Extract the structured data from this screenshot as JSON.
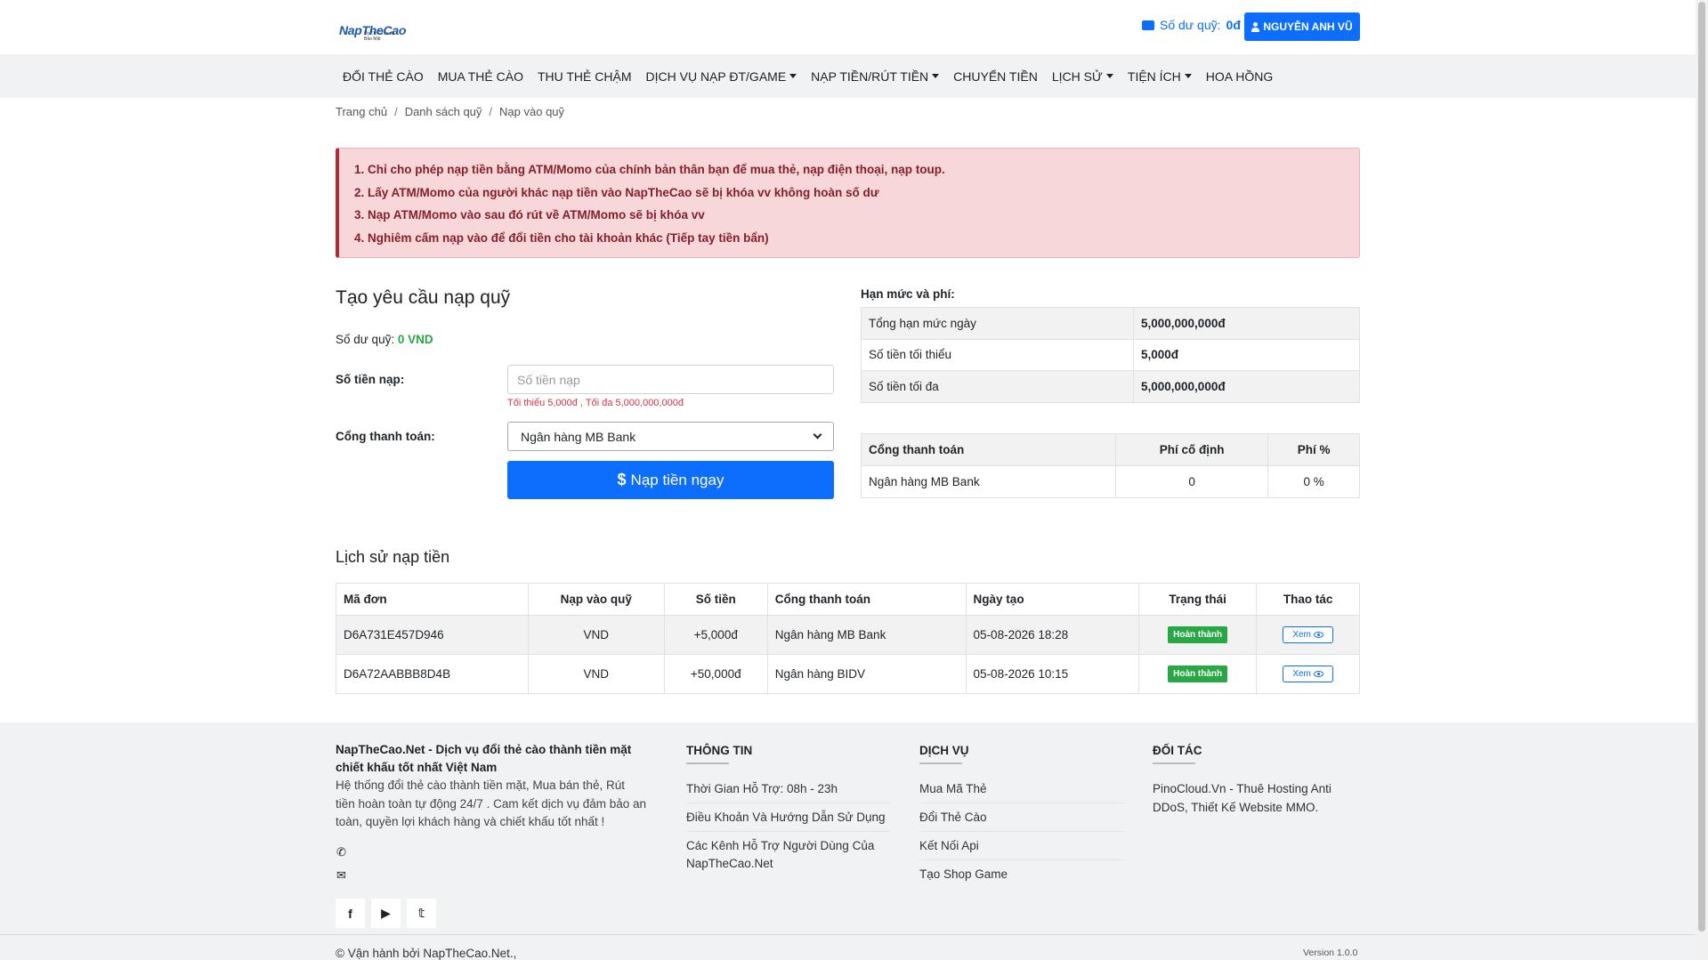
{
  "header": {
    "logo_text": "NapTheCao",
    "logo_tagline": "Uy Tín · Tốc độ · Bảo Mật",
    "balance_label": "Số dư quỹ:",
    "balance_value": "0đ",
    "user_name": "NGUYỄN ANH VŨ"
  },
  "nav": {
    "items": [
      {
        "label": "ĐỔI THẺ CÀO",
        "dropdown": false
      },
      {
        "label": "MUA THẺ CÀO",
        "dropdown": false
      },
      {
        "label": "THU THẺ CHẬM",
        "dropdown": false
      },
      {
        "label": "DỊCH VỤ NẠP ĐT/GAME",
        "dropdown": true
      },
      {
        "label": "NẠP TIỀN/RÚT TIỀN",
        "dropdown": true
      },
      {
        "label": "CHUYỂN TIỀN",
        "dropdown": false
      },
      {
        "label": "LỊCH SỬ",
        "dropdown": true
      },
      {
        "label": "TIỆN ÍCH",
        "dropdown": true
      },
      {
        "label": "HOA HỒNG",
        "dropdown": false
      }
    ]
  },
  "breadcrumb": [
    "Trang chủ",
    "Danh sách quỹ",
    "Nạp vào quỹ"
  ],
  "alert": {
    "lines": [
      "1. Chỉ cho phép nạp tiền bằng ATM/Momo của chính bản thân bạn để mua thẻ, nạp điện thoại, nạp toup.",
      "2. Lấy ATM/Momo của người khác nạp tiền vào NapTheCao sẽ bị khóa vv không hoàn số dư",
      "3. Nạp ATM/Momo vào sau đó rút về ATM/Momo sẽ bị khóa vv",
      "4. Nghiêm cấm nạp vào để đổi tiền cho tài khoản khác (Tiếp tay tiền bẩn)"
    ]
  },
  "form": {
    "title": "Tạo yêu cầu nạp quỹ",
    "balance_label": "Số dư quỹ:",
    "balance_value": "0 VND",
    "amount_label": "Số tiền nạp:",
    "amount_placeholder": "Số tiền nạp",
    "amount_value": "",
    "amount_hint": "Tối thiểu 5,000đ , Tối đa 5,000,000,000đ",
    "gateway_label": "Cổng thanh toán:",
    "gateway_selected": "Ngân hàng MB Bank",
    "submit_icon": "$",
    "submit_label": "Nạp tiền ngay"
  },
  "limits": {
    "title": "Hạn mức và phí:",
    "rows": [
      {
        "label": "Tổng hạn mức ngày",
        "value": "5,000,000,000đ"
      },
      {
        "label": "Số tiền tối thiểu",
        "value": "5,000đ"
      },
      {
        "label": "Số tiền tối đa",
        "value": "5,000,000,000đ"
      }
    ]
  },
  "fees": {
    "headers": [
      "Cổng thanh toán",
      "Phí cố định",
      "Phí %"
    ],
    "rows": [
      [
        "Ngân hàng MB Bank",
        "0",
        "0 %"
      ]
    ]
  },
  "history": {
    "title": "Lịch sử nạp tiền",
    "headers": [
      "Mã đơn",
      "Nạp vào quỹ",
      "Số tiền",
      "Cổng thanh toán",
      "Ngày tạo",
      "Trạng thái",
      "Thao tác"
    ],
    "rows": [
      {
        "id": "D6A731E457D946",
        "fund": "VND",
        "amount": "+5,000đ",
        "gateway": "Ngân hàng MB Bank",
        "created": "05-08-2026 18:28",
        "status": "Hoàn thành",
        "action": "Xem"
      },
      {
        "id": "D6A72AABBB8D4B",
        "fund": "VND",
        "amount": "+50,000đ",
        "gateway": "Ngân hàng BIDV",
        "created": "05-08-2026 10:15",
        "status": "Hoàn thành",
        "action": "Xem"
      }
    ]
  },
  "footer": {
    "about_title": "NapTheCao.Net - Dịch vụ đổi thẻ cào thành tiền mặt chiết khấu tốt nhất Việt Nam",
    "about_text": "Hệ thống đổi thẻ cào thành tiền mặt, Mua bán thẻ, Rút tiền hoàn toàn tự động 24/7 . Cam kết dịch vụ đảm bảo an toàn, quyền lợi khách hàng và chiết khấu tốt nhất !",
    "info_title": "THÔNG TIN",
    "info_items": [
      "Thời Gian Hỗ Trợ: 08h - 23h",
      "Điều Khoản Và Hướng Dẫn Sử Dụng",
      "Các Kênh Hỗ Trợ Người Dùng Của NapTheCao.Net"
    ],
    "service_title": "DỊCH VỤ",
    "service_items": [
      "Mua Mã Thẻ",
      "Đổi Thẻ Cào",
      "Kết Nối Api",
      "Tạo Shop Game"
    ],
    "partner_title": "ĐỐI TÁC",
    "partner_text": "PinoCloud.Vn - Thuê Hosting Anti DDoS, Thiết Kế Website MMO.",
    "copyright": "© Vận hành bởi NapTheCao.Net.,",
    "version": "Version 1.0.0"
  },
  "icons": {
    "wallet": "wallet-icon",
    "user": "user-icon",
    "phone": "phone-icon",
    "email": "envelope-icon",
    "facebook": "facebook-icon",
    "youtube": "youtube-icon",
    "twitter": "twitter-icon"
  },
  "colors": {
    "primary": "#0d6efd",
    "success": "#28a745",
    "danger_text": "#842029",
    "danger_bg": "#f8d7da"
  }
}
